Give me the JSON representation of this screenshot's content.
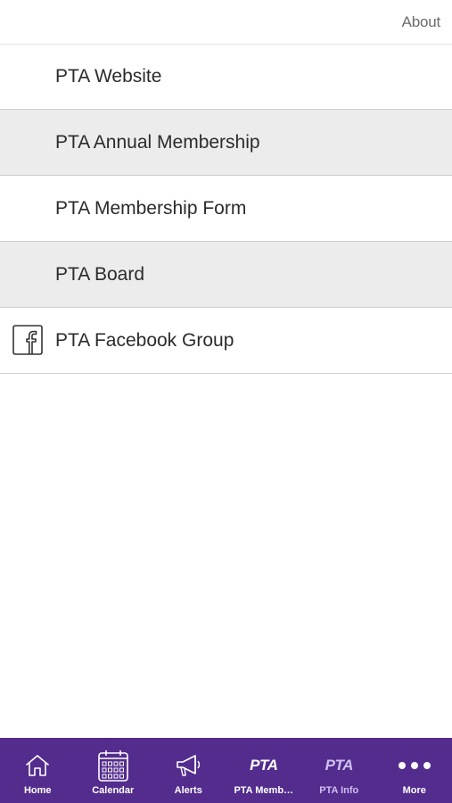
{
  "header": {
    "about_label": "About"
  },
  "list": {
    "items": [
      {
        "label": "PTA Website"
      },
      {
        "label": "PTA Annual Membership"
      },
      {
        "label": "PTA Membership Form"
      },
      {
        "label": "PTA Board"
      },
      {
        "label": "PTA Facebook Group",
        "icon": "facebook-icon"
      }
    ]
  },
  "tabbar": {
    "background": "#532c8e",
    "tabs": [
      {
        "label": "Home",
        "icon": "home-icon"
      },
      {
        "label": "Calendar",
        "icon": "calendar-icon"
      },
      {
        "label": "Alerts",
        "icon": "megaphone-icon"
      },
      {
        "label": "PTA Memb…",
        "icon": "pta-logo-icon",
        "logo_text": "PTA"
      },
      {
        "label": "PTA Info",
        "icon": "pta-logo-icon",
        "logo_text": "PTA",
        "active": true
      },
      {
        "label": "More",
        "icon": "more-dots-icon"
      }
    ]
  }
}
